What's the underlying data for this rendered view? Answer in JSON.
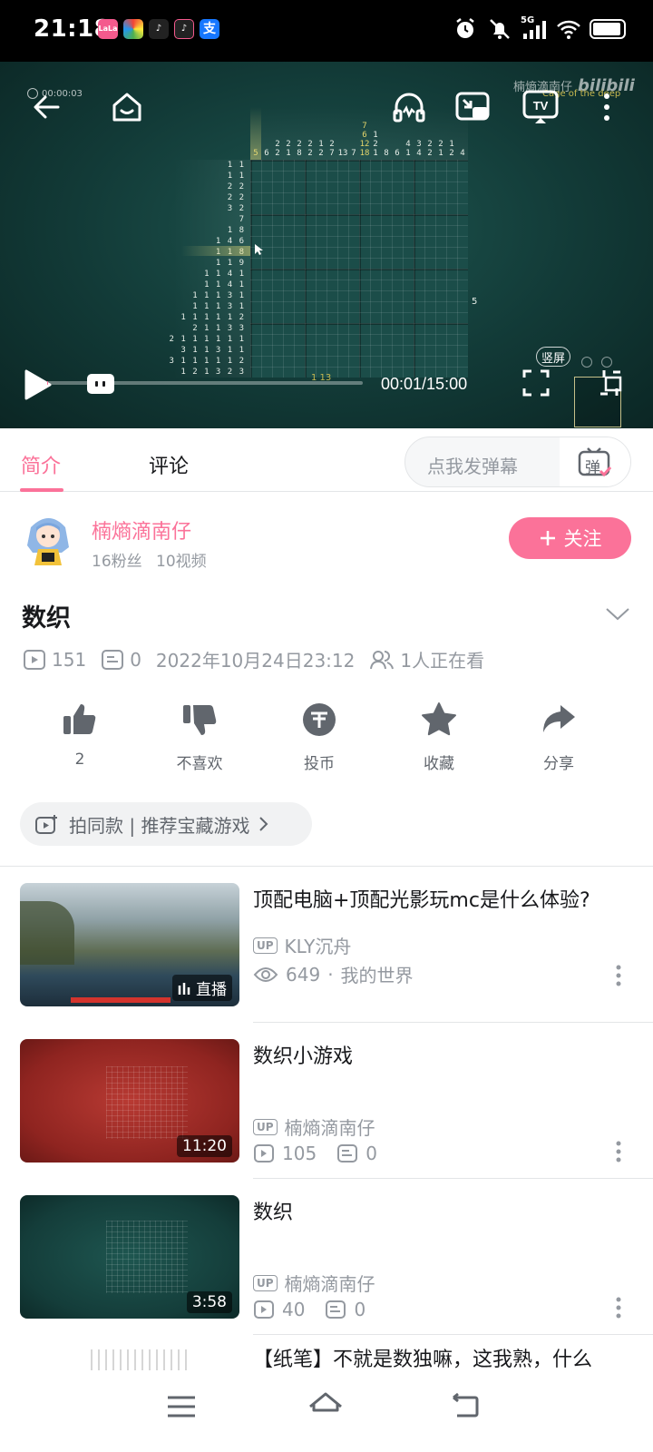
{
  "status_bar": {
    "time": "21:18",
    "apps": [
      {
        "label": "LaLa",
        "color": "#f45a8d"
      },
      {
        "label": "",
        "color": "#4caf50"
      },
      {
        "label": "♪",
        "color": "#111111"
      },
      {
        "label": "♪",
        "color": "#111111"
      },
      {
        "label": "支",
        "color": "#1677ff"
      }
    ],
    "network": "5G"
  },
  "player": {
    "elapsed_small": "00:00:03",
    "watermark": "楠熵滴南仔",
    "watermark_brand": "bilibili",
    "overlay_sub": "Cage of the deep",
    "time": "00:01/15:00",
    "vertical_label": "竖屏",
    "progress_fraction": 0.001,
    "side_number": "5",
    "bottom_clue": "1 13",
    "row_clues": [
      "1 1",
      "1 1",
      "2 2",
      "2 2",
      "3 2",
      "7",
      "1 8",
      "1 4 6",
      "1 1 8",
      "1 1 9",
      "1 1 4 1",
      "1 1 4 1",
      "1 1 1 3 1",
      "1 1 1 3 1",
      "1 1 1 1 1 2",
      "2 1 1 3 3",
      "2 1 1 1 1 1 1",
      "3 1 1 3 1 1",
      "3 1 1 1 1 1 2",
      "1 2 1 3 2 3"
    ],
    "col_clues": [
      "5",
      "6",
      "2 2",
      "2 1",
      "2 8",
      "2 2",
      "1 2",
      "2 7",
      "13",
      "7",
      "7 6 12 18",
      "1 2 1",
      "8",
      "6",
      "4 1",
      "3 4",
      "2 2",
      "2 1",
      "1 2",
      "4"
    ]
  },
  "tabs": {
    "intro": "简介",
    "comments": "评论",
    "danmu_placeholder": "点我发弹幕",
    "danmu_icon": "弹"
  },
  "uploader": {
    "name": "楠熵滴南仔",
    "stats": "16粉丝 10视频",
    "follow_label": "关注"
  },
  "video": {
    "title": "数织",
    "views": "151",
    "danmaku": "0",
    "date": "2022年10月24日23:12",
    "watching": "1人正在看"
  },
  "actions": [
    {
      "label": "2",
      "icon": "thumb-up-icon"
    },
    {
      "label": "不喜欢",
      "icon": "thumb-down-icon"
    },
    {
      "label": "投币",
      "icon": "coin-icon"
    },
    {
      "label": "收藏",
      "icon": "star-icon"
    },
    {
      "label": "分享",
      "icon": "share-icon"
    }
  ],
  "tag_pill": "拍同款 | 推荐宝藏游戏",
  "recommendations": [
    {
      "title": "顶配电脑+顶配光影玩mc是什么体验?",
      "up": "KLY沉舟",
      "stat1": "649",
      "stat2": "我的世界",
      "badge": "直播",
      "kind": "live"
    },
    {
      "title": "数织小游戏",
      "up": "楠熵滴南仔",
      "stat1": "105",
      "stat2": "0",
      "badge": "11:20",
      "kind": "video"
    },
    {
      "title": "数织",
      "up": "楠熵滴南仔",
      "stat1": "40",
      "stat2": "0",
      "badge": "3:58",
      "kind": "video"
    },
    {
      "title": "【纸笔】不就是数独嘛，这我熟，什么",
      "up": "",
      "stat1": "",
      "stat2": "",
      "badge": "",
      "kind": "partial"
    }
  ],
  "colors": {
    "accent": "#fb7299",
    "muted": "#9499a0",
    "text": "#18191c"
  }
}
